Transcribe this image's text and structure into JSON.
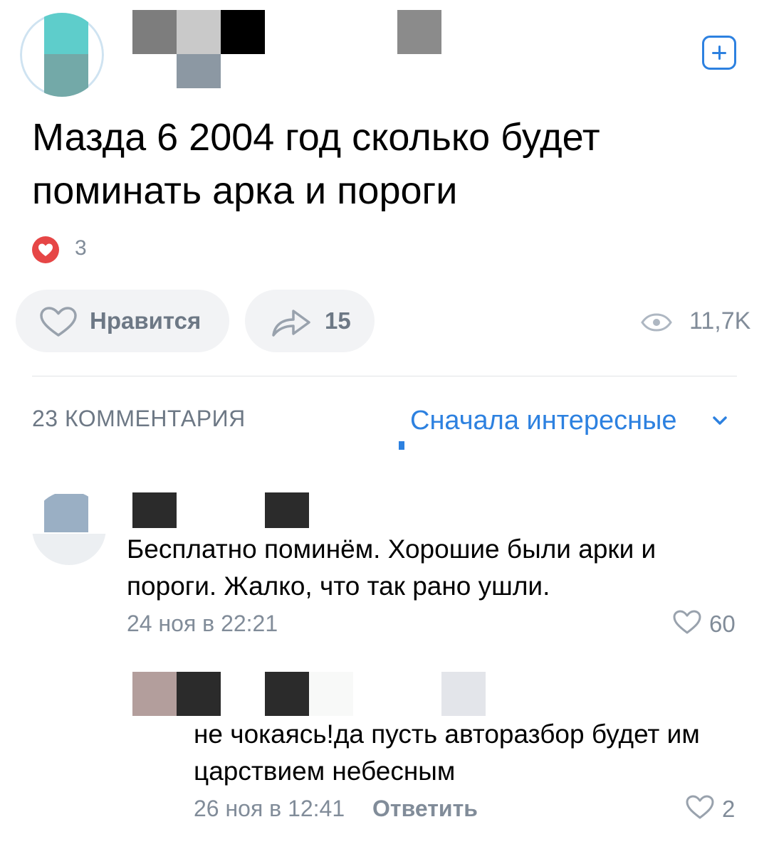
{
  "post": {
    "title": "Мазда 6 2004 год сколько будет поминать арка и пороги",
    "reactions_count": "3",
    "like_label": "Нравится",
    "shares_count": "15",
    "views_count": "11,7K"
  },
  "comments_header": {
    "count_label": "23 КОММЕНТАРИЯ",
    "sort_label": "Сначала интересные"
  },
  "comments": [
    {
      "text": "Бесплатно поминём. Хорошие были арки и пороги.  Жалко, что так рано ушли.",
      "meta": "24 ноя в 22:21",
      "likes": "60"
    },
    {
      "text": "не чокаясь!да пусть авторазбор будет им царствием небесным",
      "meta": "26 ноя в 12:41",
      "reply_label": "Ответить",
      "likes": "2"
    }
  ],
  "colors": {
    "accent": "#2d81e0",
    "secondary_text": "#818c99",
    "button_bg": "#f2f3f5",
    "reaction_red": "#e64646"
  }
}
